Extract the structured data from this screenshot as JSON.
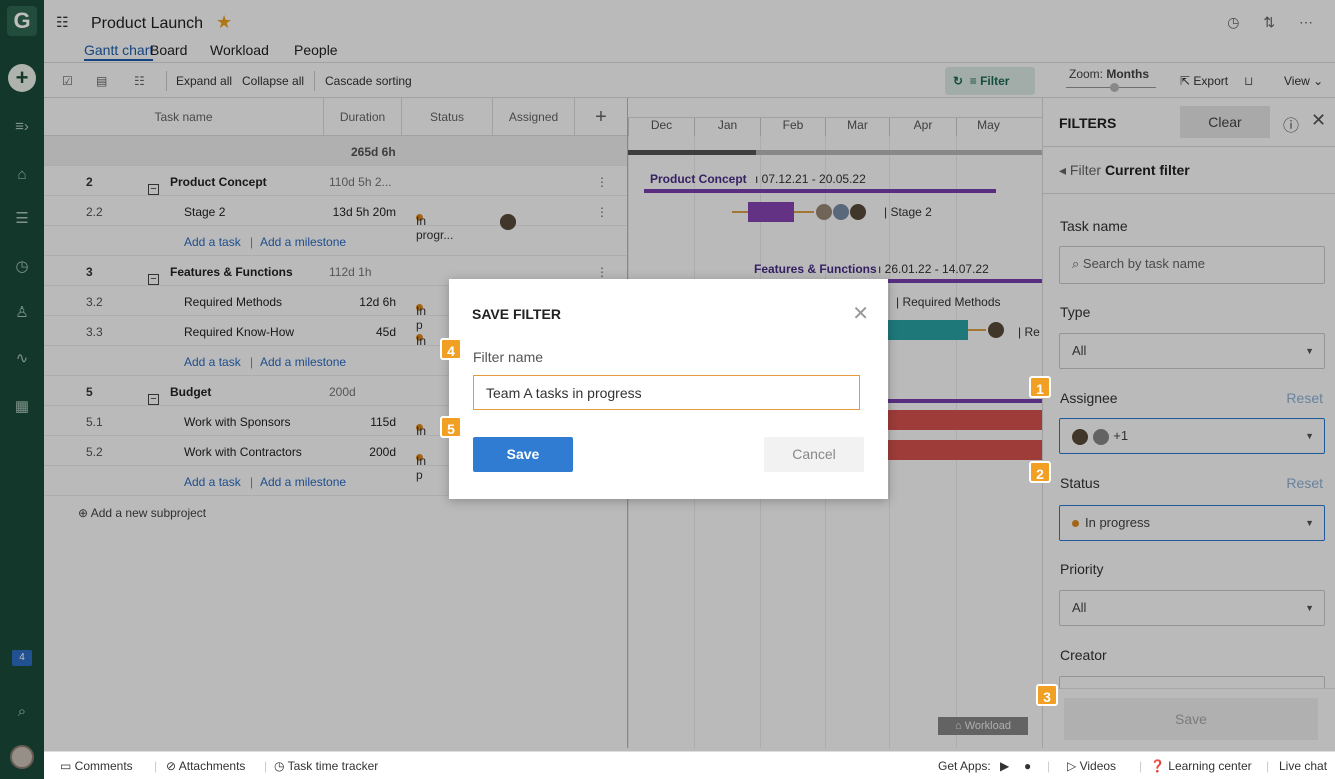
{
  "header": {
    "project_title": "Product Launch",
    "tabs": [
      "Gantt chart",
      "Board",
      "Workload",
      "People"
    ]
  },
  "toolbar": {
    "expand_all": "Expand all",
    "collapse_all": "Collapse all",
    "cascade_sorting": "Cascade sorting",
    "filter": "Filter",
    "zoom_label": "Zoom:",
    "zoom_value": "Months",
    "export": "Export",
    "view": "View"
  },
  "grid": {
    "columns": [
      "Task name",
      "Duration",
      "Status",
      "Assigned"
    ],
    "total_duration": "265d 6h",
    "rows": [
      {
        "num": "2",
        "name": "Product Concept",
        "duration": "110d 5h 2...",
        "status": "",
        "group": true
      },
      {
        "num": "2.2",
        "name": "Stage 2",
        "duration": "13d 5h 20m",
        "status": "In progr...",
        "group": false
      },
      {
        "add": true
      },
      {
        "num": "3",
        "name": "Features & Functions",
        "duration": "112d 1h",
        "status": "",
        "group": true
      },
      {
        "num": "3.2",
        "name": "Required Methods",
        "duration": "12d 6h",
        "status": "In p",
        "group": false
      },
      {
        "num": "3.3",
        "name": "Required Know-How",
        "duration": "45d",
        "status": "In",
        "group": false
      },
      {
        "add": true
      },
      {
        "num": "5",
        "name": "Budget",
        "duration": "200d",
        "status": "",
        "group": true
      },
      {
        "num": "5.1",
        "name": "Work with Sponsors",
        "duration": "115d",
        "status": "In",
        "group": false
      },
      {
        "num": "5.2",
        "name": "Work with Contractors",
        "duration": "200d",
        "status": "In p",
        "group": false
      },
      {
        "add": true
      }
    ],
    "add_task": "Add a task",
    "add_milestone": "Add a milestone",
    "add_subproject": "Add a new subproject"
  },
  "chart": {
    "months": [
      "Dec",
      "Jan",
      "Feb",
      "Mar",
      "Apr",
      "May"
    ],
    "product_concept_label": "Product Concept",
    "product_concept_dates": "07.12.21 - 20.05.22",
    "stage2_label": "Stage 2",
    "features_label": "Features & Functions",
    "features_dates": "26.01.22 - 14.07.22",
    "required_methods_label": "Required Methods",
    "required_knowhow_label": "Re",
    "workload_tab": "Workload"
  },
  "filters": {
    "title": "FILTERS",
    "clear": "Clear",
    "breadcrumb_prefix": "Filter",
    "breadcrumb_current": "Current filter",
    "task_name_label": "Task name",
    "task_name_placeholder": "Search by task name",
    "type_label": "Type",
    "type_value": "All",
    "assignee_label": "Assignee",
    "assignee_reset": "Reset",
    "assignee_extra": "+1",
    "status_label": "Status",
    "status_reset": "Reset",
    "status_value": "In progress",
    "priority_label": "Priority",
    "priority_value": "All",
    "creator_label": "Creator",
    "save": "Save"
  },
  "modal": {
    "title": "SAVE FILTER",
    "filter_name_label": "Filter name",
    "filter_name_value": "Team A tasks in progress",
    "save": "Save",
    "cancel": "Cancel"
  },
  "badges": [
    "1",
    "2",
    "3",
    "4",
    "5"
  ],
  "bottombar": {
    "comments": "Comments",
    "attachments": "Attachments",
    "time_tracker": "Task time tracker",
    "get_apps": "Get Apps:",
    "videos": "Videos",
    "learning_center": "Learning center",
    "live_chat": "Live chat"
  },
  "sidebar": {
    "notification_count": "4"
  },
  "colors": {
    "sidebar_bg": "#1b4a3a",
    "accent_blue": "#2f7cd2",
    "badge_orange": "#f2a024",
    "status_dot": "#e08a1e",
    "bar_purple": "#7b3fb0",
    "bar_teal": "#2aa5a8",
    "bar_red": "#d9534f"
  }
}
